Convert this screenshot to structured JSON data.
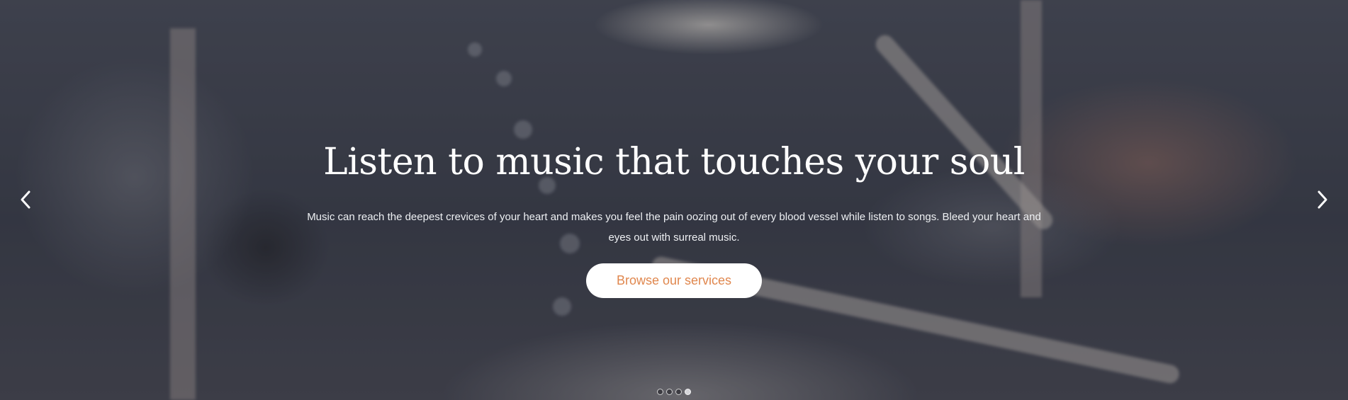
{
  "hero": {
    "title": "Listen to music that touches your soul",
    "description": "Music can reach the deepest crevices of your heart and makes you feel the pain oozing out of every blood vessel while listen to songs. Bleed your heart and eyes out with surreal music.",
    "cta_label": "Browse our services",
    "cta_color": "#e0874e"
  },
  "carousel": {
    "prev_icon": "chevron-left-icon",
    "next_icon": "chevron-right-icon",
    "slide_count": 4,
    "active_slide": 4
  }
}
